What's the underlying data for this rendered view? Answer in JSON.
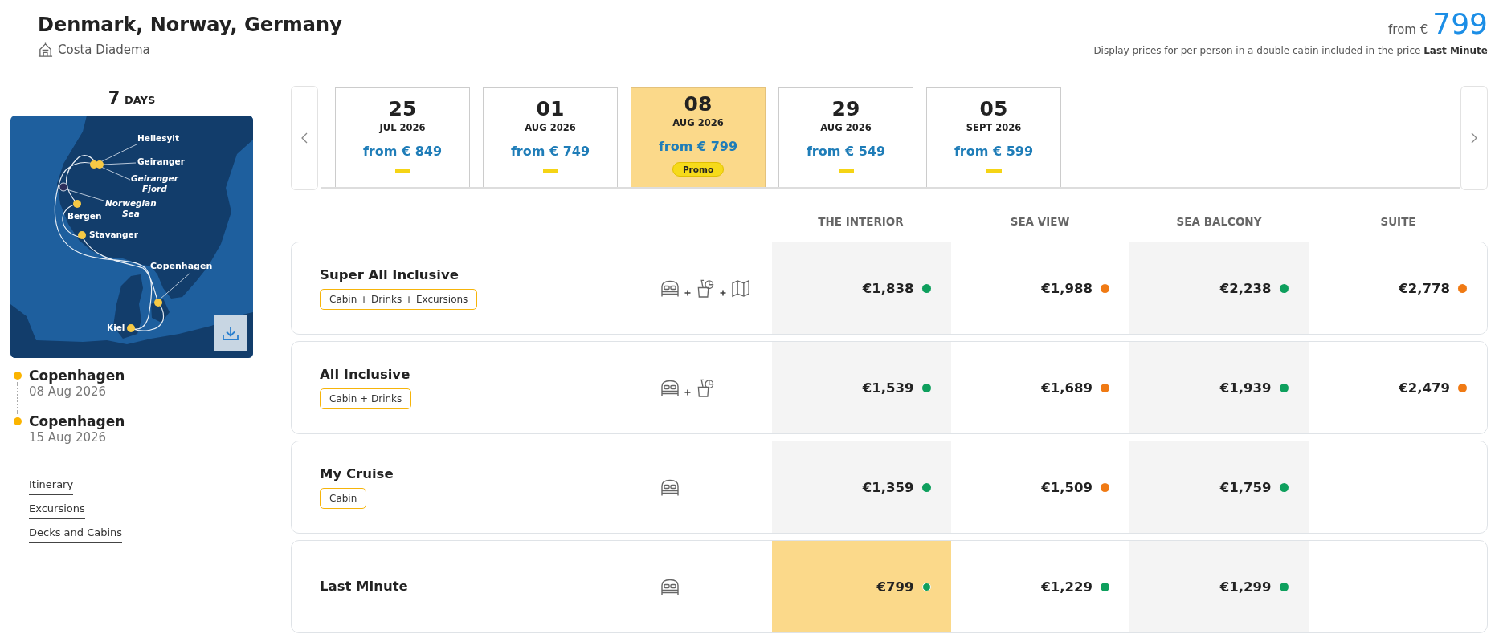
{
  "header": {
    "title": "Denmark, Norway, Germany",
    "ship": "Costa Diadema",
    "price_prefix": "from €",
    "price": "799",
    "note": "Display prices for per person in a double cabin included in the price **Last Minute**"
  },
  "duration": {
    "number": "7",
    "unit": "DAYS"
  },
  "map": {
    "labels": [
      {
        "text": "Hellesylt",
        "kind": "port"
      },
      {
        "text": "Geiranger",
        "kind": "port"
      },
      {
        "text": "Geiranger Fjord",
        "kind": "water"
      },
      {
        "text": "Norwegian Sea",
        "kind": "water"
      },
      {
        "text": "Bergen",
        "kind": "port"
      },
      {
        "text": "Stavanger",
        "kind": "port"
      },
      {
        "text": "Copenhagen",
        "kind": "homeport"
      },
      {
        "text": "Kiel",
        "kind": "port"
      }
    ]
  },
  "stops": [
    {
      "city": "Copenhagen",
      "date": "08 Aug 2026"
    },
    {
      "city": "Copenhagen",
      "date": "15 Aug 2026"
    }
  ],
  "links": [
    "Itinerary",
    "Excursions",
    "Decks and Cabins"
  ],
  "dates": [
    {
      "day": "25",
      "month": "JUL 2026",
      "price": "from € 849",
      "selected": false
    },
    {
      "day": "01",
      "month": "AUG 2026",
      "price": "from € 749",
      "selected": false
    },
    {
      "day": "08",
      "month": "AUG 2026",
      "price": "from € 799",
      "selected": true,
      "badge": "Promo"
    },
    {
      "day": "29",
      "month": "AUG 2026",
      "price": "from € 549",
      "selected": false
    },
    {
      "day": "05",
      "month": "SEPT 2026",
      "price": "from € 599",
      "selected": false
    }
  ],
  "columns": [
    "THE INTERIOR",
    "SEA VIEW",
    "SEA BALCONY",
    "SUITE"
  ],
  "fares": [
    {
      "name": "Super All Inclusive",
      "tag": "Cabin + Drinks + Excursions",
      "icons": [
        {
          "kind": "cabin"
        },
        {
          "kind": "drinks"
        },
        {
          "kind": "excursions"
        }
      ],
      "prices": [
        {
          "amount": "€1,838",
          "color": "#0e9f5d",
          "selected": false
        },
        {
          "amount": "€1,988",
          "color": "#f07a14",
          "selected": false
        },
        {
          "amount": "€2,238",
          "color": "#0e9f5d",
          "selected": false
        },
        {
          "amount": "€2,778",
          "color": "#f07a14",
          "selected": false
        }
      ]
    },
    {
      "name": "All Inclusive",
      "tag": "Cabin + Drinks",
      "icons": [
        {
          "kind": "cabin"
        },
        {
          "kind": "drinks"
        }
      ],
      "prices": [
        {
          "amount": "€1,539",
          "color": "#0e9f5d",
          "selected": false
        },
        {
          "amount": "€1,689",
          "color": "#f07a14",
          "selected": false
        },
        {
          "amount": "€1,939",
          "color": "#0e9f5d",
          "selected": false
        },
        {
          "amount": "€2,479",
          "color": "#f07a14",
          "selected": false
        }
      ]
    },
    {
      "name": "My Cruise",
      "tag": "Cabin",
      "icons": [
        {
          "kind": "cabin"
        }
      ],
      "prices": [
        {
          "amount": "€1,359",
          "color": "#0e9f5d",
          "selected": false
        },
        {
          "amount": "€1,509",
          "color": "#f07a14",
          "selected": false
        },
        {
          "amount": "€1,759",
          "color": "#0e9f5d",
          "selected": false
        }
      ]
    },
    {
      "name": "Last Minute",
      "icons": [
        {
          "kind": "cabin"
        }
      ],
      "prices": [
        {
          "amount": "€799",
          "color": "#0e9f5d",
          "selected": true
        },
        {
          "amount": "€1,229",
          "color": "#0e9f5d",
          "selected": false
        },
        {
          "amount": "€1,299",
          "color": "#0e9f5d",
          "selected": false
        }
      ]
    }
  ]
}
